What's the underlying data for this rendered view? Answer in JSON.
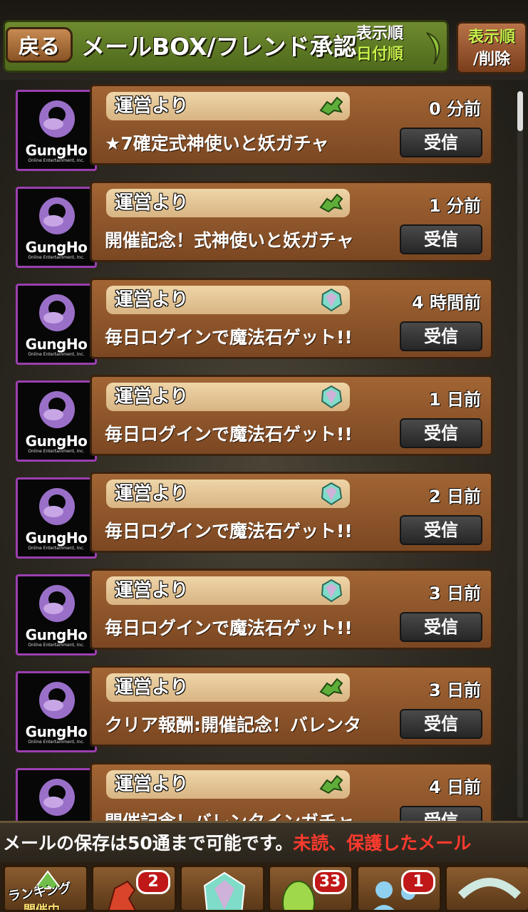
{
  "header": {
    "back_label": "戻る",
    "title": "メールBOX/フレンド承認",
    "sort_label": "表示順",
    "sort_value": "日付順",
    "sort_delete_line1": "表示順",
    "sort_delete_line2": "/削除"
  },
  "avatar": {
    "brand": "GungHo",
    "brand_sub": "Online Entertainment, Inc."
  },
  "mails": [
    {
      "sender": "運営より",
      "subject": "★7確定式神使いと妖ガチャ",
      "time": "0 分前",
      "attachment": "dragon-icon",
      "button": "受信"
    },
    {
      "sender": "運営より",
      "subject": "開催記念！式神使いと妖ガチャ",
      "time": "1 分前",
      "attachment": "dragon-icon",
      "button": "受信"
    },
    {
      "sender": "運営より",
      "subject": "毎日ログインで魔法石ゲット!!",
      "time": "4 時間前",
      "attachment": "magic-stone-icon",
      "button": "受信"
    },
    {
      "sender": "運営より",
      "subject": "毎日ログインで魔法石ゲット!!",
      "time": "1 日前",
      "attachment": "magic-stone-icon",
      "button": "受信"
    },
    {
      "sender": "運営より",
      "subject": "毎日ログインで魔法石ゲット!!",
      "time": "2 日前",
      "attachment": "magic-stone-icon",
      "button": "受信"
    },
    {
      "sender": "運営より",
      "subject": "毎日ログインで魔法石ゲット!!",
      "time": "3 日前",
      "attachment": "magic-stone-icon",
      "button": "受信"
    },
    {
      "sender": "運営より",
      "subject": "クリア報酬:開催記念！バレンタ",
      "time": "3 日前",
      "attachment": "dragon-icon",
      "button": "受信"
    },
    {
      "sender": "運営より",
      "subject": "開催記念！バレンタインガチャ",
      "time": "4 日前",
      "attachment": "dragon-icon",
      "button": "受信"
    }
  ],
  "notice": {
    "normal": "メールの保存は50通まで可能です。",
    "highlight": "未読、保護したメール"
  },
  "nav": {
    "ranking_line1": "ランキング",
    "ranking_line2": "開催中",
    "monster_badge": "2",
    "egg_badge": "33",
    "friend_badge": "1"
  },
  "colors": {
    "accent_green": "#c8f04a",
    "notice_red": "#ff3a2e",
    "avatar_border": "#9b3fb0",
    "card_brown": "#a26534"
  }
}
